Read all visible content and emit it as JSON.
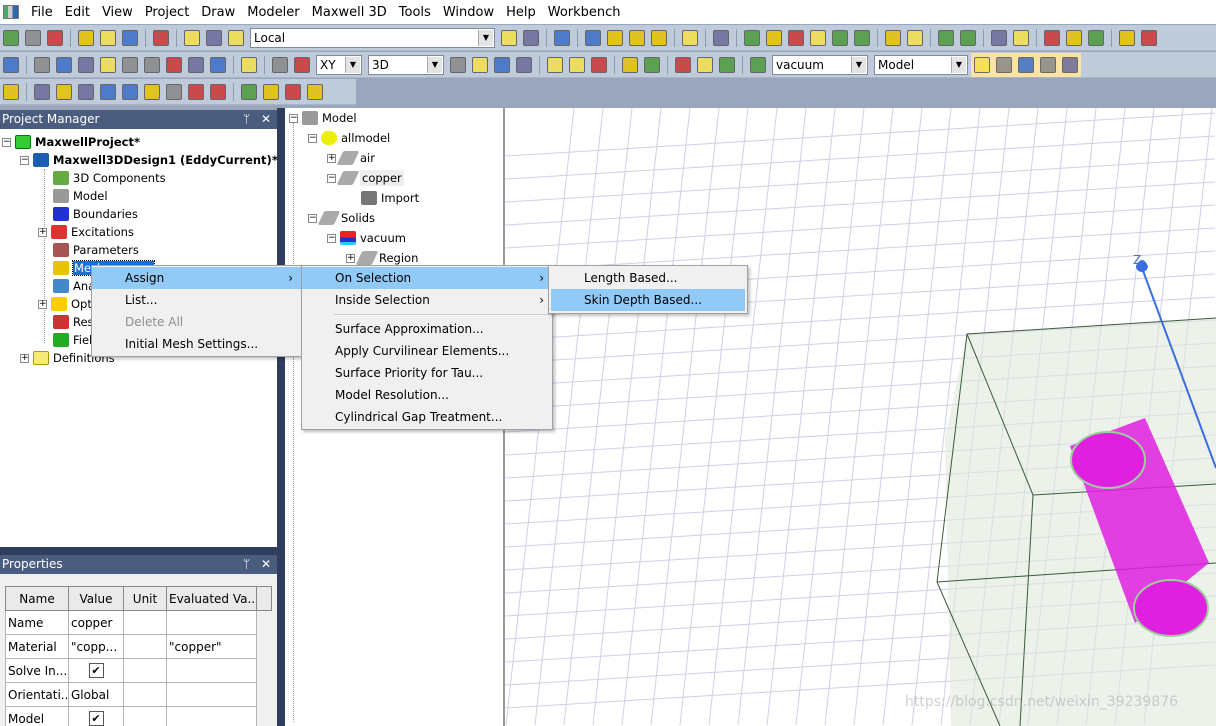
{
  "menubar": {
    "items": [
      "File",
      "Edit",
      "View",
      "Project",
      "Draw",
      "Modeler",
      "Maxwell 3D",
      "Tools",
      "Window",
      "Help",
      "Workbench"
    ]
  },
  "toolbar": {
    "row1_left_icons": [
      "new-icon",
      "open-icon",
      "save-icon",
      "|",
      "cut-icon",
      "copy-icon",
      "paste-icon",
      "|",
      "print-icon",
      "|",
      "delete-icon",
      "undo-icon",
      "redo-icon"
    ],
    "coordinate_system": "Local",
    "row1_right_icons": [
      "cs-icon",
      "cs-tree-icon",
      "|",
      "q-icon",
      "|",
      "script-icon",
      "validate-icon",
      "analyze-icon",
      "report-icon",
      "|",
      "field-overlay-icon",
      "|",
      "copy-image-icon",
      "|",
      "pan-icon",
      "rotate-icon",
      "rotate-axis-icon",
      "rotate-screen-icon",
      "orient-icon",
      "dynamic-zoom-icon",
      "|",
      "zoom-in-icon",
      "zoom-out-icon",
      "|",
      "fit-all-icon",
      "fit-selection-icon",
      "|",
      "undo-view-icon",
      "redo-view-icon",
      "|",
      "show-icon",
      "hide-icon",
      "hide-selected-icon",
      "|",
      "show-all-icon",
      "show-selected-icon"
    ],
    "row2_left_icons": [
      "help-icon",
      "|",
      "box-icon",
      "cylinder-icon",
      "regular-polyhedron-icon",
      "cone-icon",
      "sphere-icon",
      "torus-icon",
      "helix-icon",
      "spiral-icon",
      "bondwire-icon",
      "|",
      "relative-cs-icon",
      "|",
      "point-icon",
      "plane-icon"
    ],
    "plane": "XY",
    "dimension": "3D",
    "row2_mid_icons": [
      "unite-icon",
      "subtract-icon",
      "intersect-icon",
      "split-icon",
      "|",
      "move-icon",
      "rotate-obj-icon",
      "mirror-icon",
      "|",
      "sweep-icon",
      "thicken-icon",
      "|",
      "dup-move-icon",
      "dup-rotate-icon",
      "dup-mirror-icon",
      "|",
      "material-icon"
    ],
    "material": "vacuum",
    "selection_mode": "Model",
    "row2_right_icons": [
      "snap-grid-icon",
      "snap-vertex-icon",
      "snap-edge-icon",
      "snap-face-icon",
      "snap-center-icon"
    ],
    "row3_icons": [
      "measure-icon",
      "|",
      "object-select-icon",
      "face-select-icon",
      "edge-select-icon",
      "vertex-select-icon",
      "multi-select-icon",
      "select-by-name-icon",
      "select-body-icon",
      "select-face-icon",
      "select-all-icon",
      "|",
      "add-variable-icon",
      "delete-variable-icon",
      "import-icon",
      "export-icon"
    ]
  },
  "project_manager": {
    "title": "Project Manager",
    "project": "MaxwellProject*",
    "design": "Maxwell3DDesign1 (EddyCurrent)*",
    "items": [
      "3D Components",
      "Model",
      "Boundaries",
      "Excitations",
      "Parameters",
      "Mesh",
      "Analysis",
      "Optimetrics",
      "Results",
      "Field Overlays"
    ],
    "visible_items": [
      "3D Components",
      "Model",
      "Boundaries",
      "Excitations",
      "Parameters",
      "Mes",
      "Ana",
      "Opt",
      "Res",
      "Fiel"
    ],
    "definitions": "Definitions"
  },
  "model_tree": {
    "root": "Model",
    "allmodel": "allmodel",
    "air": "air",
    "copper": "copper",
    "import": "Import",
    "solids": "Solids",
    "vacuum": "vacuum",
    "region": "Region"
  },
  "context_menu": {
    "items": [
      {
        "label": "Assign",
        "submenu": true
      },
      {
        "label": "List..."
      },
      {
        "label": "Delete All",
        "disabled": true
      },
      {
        "label": "Initial Mesh Settings..."
      }
    ]
  },
  "assign_submenu": {
    "items": [
      "On Selection",
      "Inside Selection",
      "Surface Approximation...",
      "Apply Curvilinear Elements...",
      "Surface Priority for Tau...",
      "Model Resolution...",
      "Cylindrical Gap Treatment..."
    ]
  },
  "on_selection_submenu": {
    "items": [
      "Length Based...",
      "Skin Depth Based..."
    ]
  },
  "properties": {
    "title": "Properties",
    "columns": [
      "Name",
      "Value",
      "Unit",
      "Evaluated Va..."
    ],
    "rows": [
      [
        "Name",
        "copper",
        "",
        ""
      ],
      [
        "Material",
        "\"copp...",
        "",
        "\"copper\""
      ],
      [
        "Solve In...",
        "checked",
        "",
        ""
      ],
      [
        "Orientati...",
        "Global",
        "",
        ""
      ],
      [
        "Model",
        "checked",
        "",
        ""
      ]
    ]
  },
  "viewport": {
    "axis_label": "Z",
    "watermark": "https://blog.csdn.net/weixin_39239876",
    "object_color": "#e020e0",
    "axis_color": "#3a6ee0"
  },
  "panel_controls": {
    "pin": "ᛘ",
    "close": "✕"
  }
}
